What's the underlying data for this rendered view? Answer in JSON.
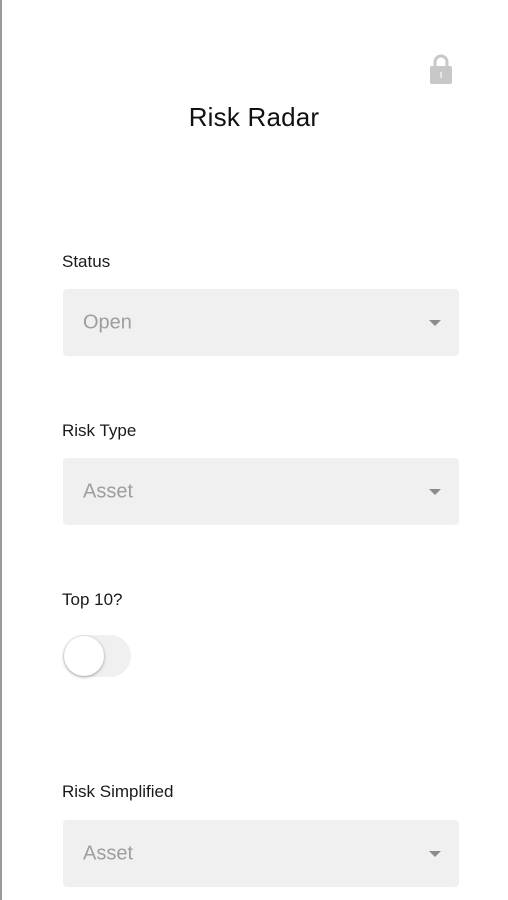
{
  "header": {
    "title": "Risk Radar",
    "lock_icon": "lock-icon"
  },
  "fields": {
    "status": {
      "label": "Status",
      "value": "Open"
    },
    "risk_type": {
      "label": "Risk Type",
      "value": "Asset"
    },
    "top10": {
      "label": "Top 10?",
      "toggle_on": false
    },
    "risk_simplified": {
      "label": "Risk Simplified",
      "value": "Asset"
    }
  },
  "colors": {
    "field_background": "#f0f0f0",
    "placeholder_text": "#9e9e9e",
    "lock_icon": "#c8c8c8"
  }
}
